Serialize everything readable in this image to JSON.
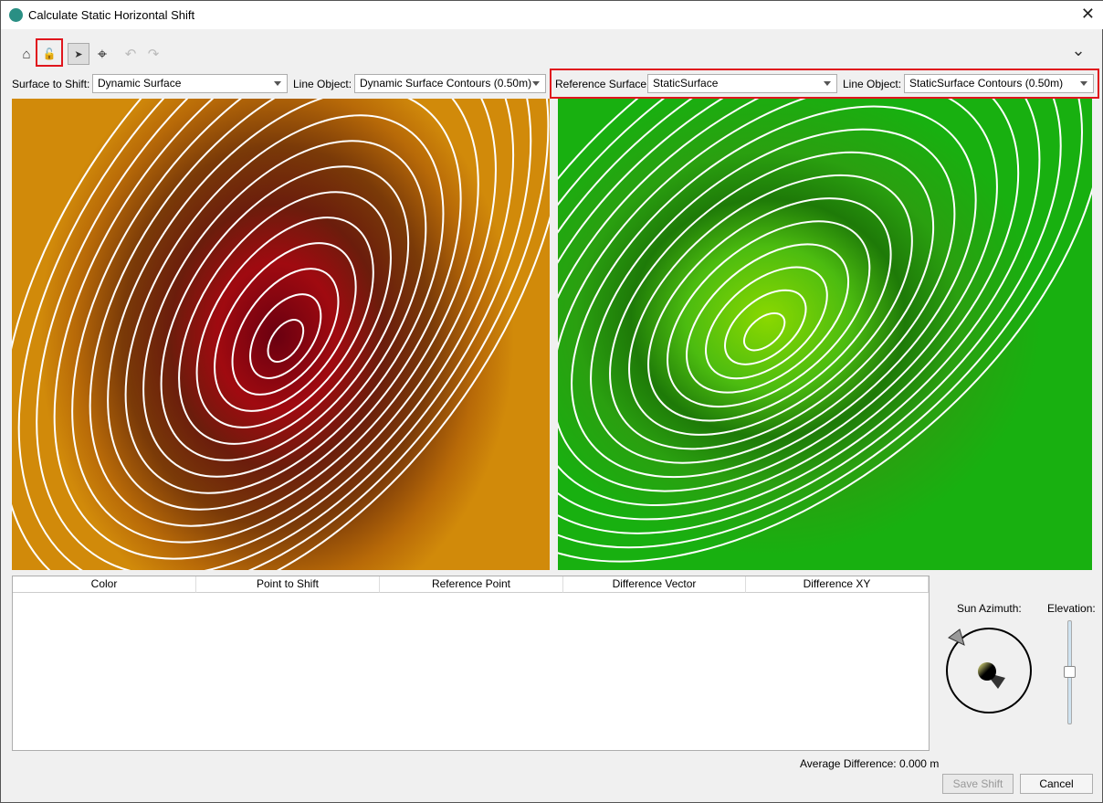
{
  "window": {
    "title": "Calculate Static Horizontal Shift",
    "close": "✕"
  },
  "toolbar": {
    "home": "⌂",
    "unlock": "🔓",
    "select": "➤",
    "target": "⌖",
    "undo": "↶",
    "redo": "↷",
    "collapse": "⌄"
  },
  "selectors": {
    "surface_to_shift_label": "Surface to Shift:",
    "surface_to_shift": "Dynamic Surface",
    "line_object_label_1": "Line Object:",
    "line_object_1": "Dynamic Surface Contours (0.50m)",
    "reference_surface_label": "Reference Surface:",
    "reference_surface": "StaticSurface",
    "line_object_label_2": "Line Object:",
    "line_object_2": "StaticSurface Contours (0.50m)"
  },
  "table": {
    "columns": [
      "Color",
      "Point to Shift",
      "Reference Point",
      "Difference Vector",
      "Difference XY"
    ],
    "rows": []
  },
  "sun": {
    "azimuth_label": "Sun Azimuth:",
    "elevation_label": "Elevation:",
    "elevation_fraction": 0.4
  },
  "average_difference": "Average Difference: 0.000 m",
  "buttons": {
    "save": "Save Shift",
    "cancel": "Cancel"
  },
  "colors": {
    "highlight": "#e0161d"
  }
}
